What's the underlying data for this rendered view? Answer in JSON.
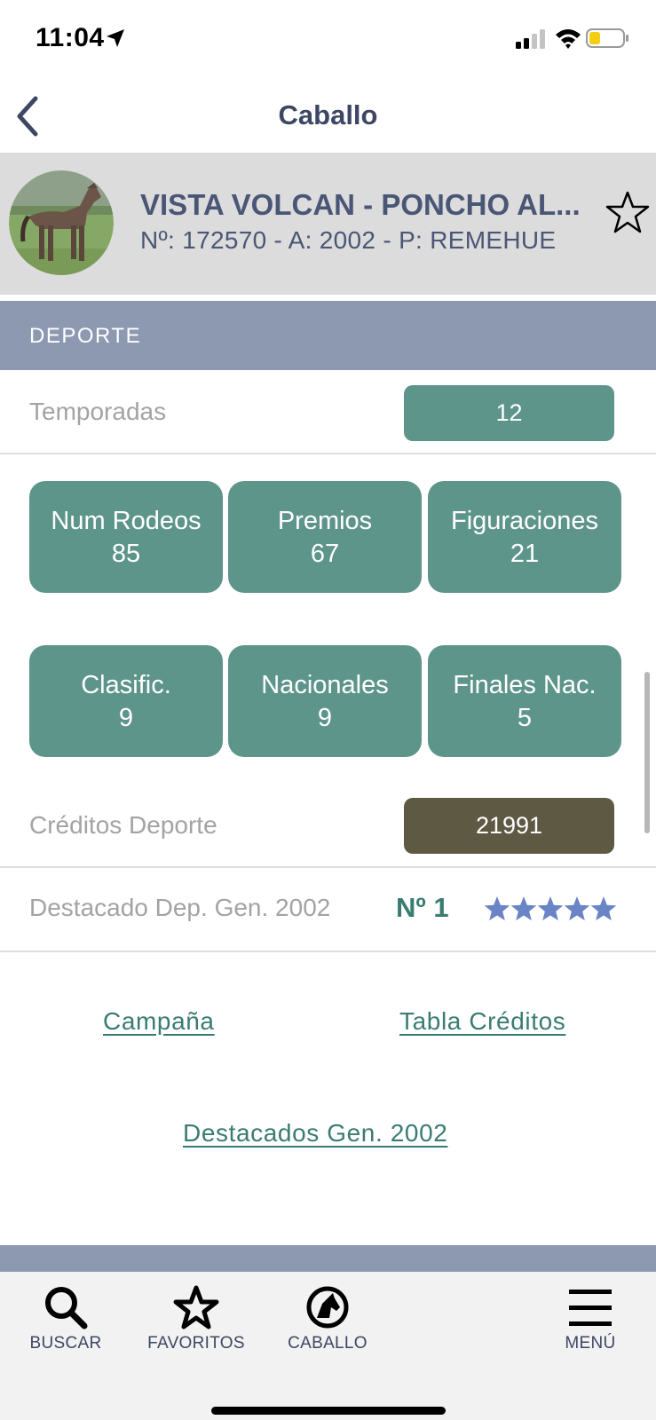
{
  "status_bar": {
    "time": "11:04",
    "icons": [
      "location-arrow-icon",
      "cellular-signal-icon",
      "wifi-icon",
      "battery-low-icon"
    ],
    "battery_color": "#f5cd11"
  },
  "nav": {
    "title": "Caballo",
    "back_icon": "chevron-left-icon"
  },
  "horse": {
    "name": "VISTA VOLCAN - PONCHO AL...",
    "info": "Nº: 172570 - A: 2002 - P: REMEHUE",
    "favorite_icon": "star-outline-icon"
  },
  "section": {
    "title": "DEPORTE"
  },
  "temporadas": {
    "label": "Temporadas",
    "value": "12"
  },
  "stats": [
    {
      "label": "Num Rodeos",
      "value": "85"
    },
    {
      "label": "Premios",
      "value": "67"
    },
    {
      "label": "Figuraciones",
      "value": "21"
    },
    {
      "label": "Clasific.",
      "value": "9"
    },
    {
      "label": "Nacionales",
      "value": "9"
    },
    {
      "label": "Finales Nac.",
      "value": "5"
    }
  ],
  "creditos": {
    "label": "Créditos Deporte",
    "value": "21991"
  },
  "destacado": {
    "label": "Destacado Dep. Gen. 2002",
    "rank": "Nº 1",
    "stars": 5,
    "stars_max": 5
  },
  "links": {
    "campana": "Campaña",
    "tabla_creditos": "Tabla Créditos",
    "destacados_gen": "Destacados Gen. 2002"
  },
  "tab_bar": {
    "buscar": "BUSCAR",
    "favoritos": "FAVORITOS",
    "caballo": "CABALLO",
    "menu": "MENÚ"
  },
  "colors": {
    "accent_green": "#5d958b",
    "link_green": "#3a7c72",
    "credits_pill": "#5e5943",
    "section_header": "#8d98b1",
    "star_blue": "#6a84c6",
    "title_navy": "#3d4763"
  }
}
